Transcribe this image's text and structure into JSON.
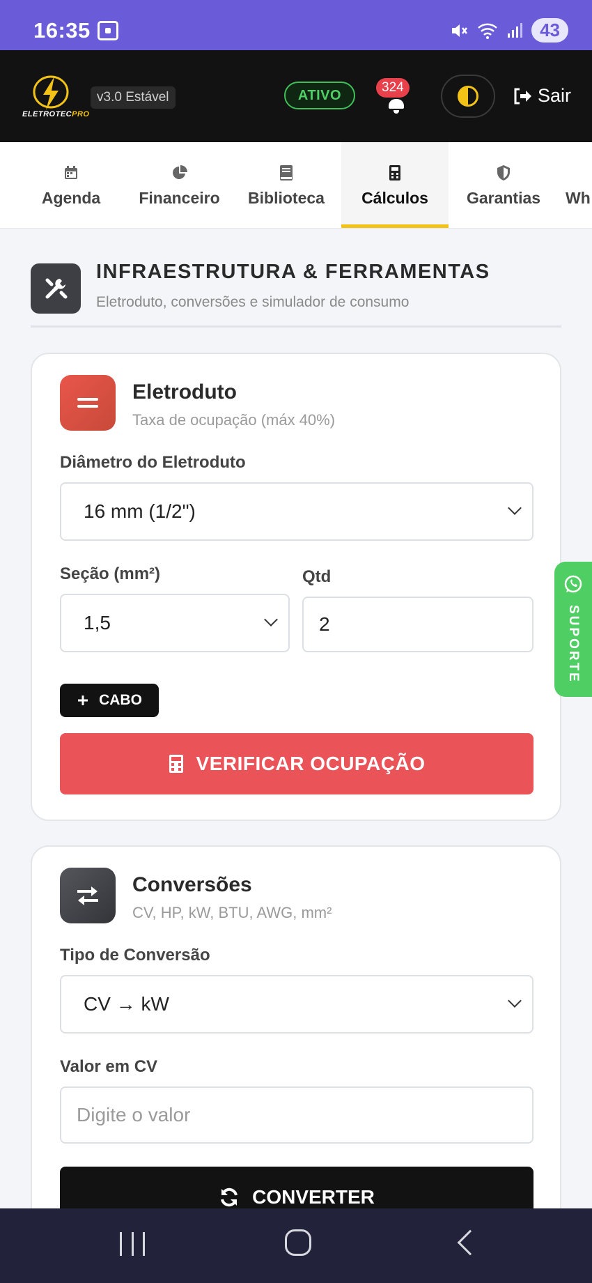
{
  "status_bar": {
    "time": "16:35",
    "battery": "43"
  },
  "header": {
    "logo_text_main": "ELETROTEC",
    "logo_text_accent": "PRO",
    "version": "v3.0 Estável",
    "status": "ATIVO",
    "notifications": "324",
    "logout": "Sair"
  },
  "tabs": [
    {
      "label": "Agenda",
      "icon": "calendar-icon"
    },
    {
      "label": "Financeiro",
      "icon": "pie-chart-icon"
    },
    {
      "label": "Biblioteca",
      "icon": "book-icon"
    },
    {
      "label": "Cálculos",
      "icon": "calculator-icon",
      "active": true
    },
    {
      "label": "Garantias",
      "icon": "shield-icon"
    },
    {
      "label": "Wh",
      "icon": "whatsapp-icon"
    }
  ],
  "section": {
    "title": "INFRAESTRUTURA & FERRAMENTAS",
    "subtitle": "Eletroduto, conversões e simulador de consumo"
  },
  "eletroduto": {
    "title": "Eletroduto",
    "subtitle": "Taxa de ocupação (máx 40%)",
    "diameter_label": "Diâmetro do Eletroduto",
    "diameter_value": "16 mm (1/2\")",
    "section_label": "Seção (mm²)",
    "section_value": "1,5",
    "qty_label": "Qtd",
    "qty_value": "2",
    "add_cable": "CABO",
    "verify_button": "VERIFICAR OCUPAÇÃO"
  },
  "conversoes": {
    "title": "Conversões",
    "subtitle": "CV, HP, kW, BTU, AWG, mm²",
    "type_label": "Tipo de Conversão",
    "type_value": "CV → kW",
    "value_label": "Valor em CV",
    "value_placeholder": "Digite o valor",
    "convert_button": "CONVERTER"
  },
  "support": {
    "label": "SUPORTE"
  },
  "colors": {
    "accent": "#f2c316",
    "danger": "#ea5459",
    "success": "#4fcf63",
    "status_bar": "#6a5bd8"
  }
}
